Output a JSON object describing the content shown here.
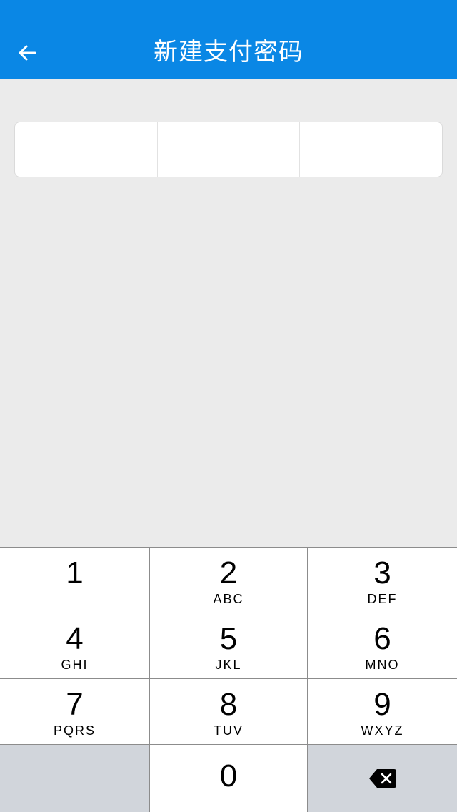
{
  "nav": {
    "title": "新建支付密码",
    "back_icon": "arrow-left-icon"
  },
  "pin": {
    "length": 6,
    "filled": 0
  },
  "keypad": {
    "keys": [
      {
        "digit": "1",
        "letters": ""
      },
      {
        "digit": "2",
        "letters": "ABC"
      },
      {
        "digit": "3",
        "letters": "DEF"
      },
      {
        "digit": "4",
        "letters": "GHI"
      },
      {
        "digit": "5",
        "letters": "JKL"
      },
      {
        "digit": "6",
        "letters": "MNO"
      },
      {
        "digit": "7",
        "letters": "PQRS"
      },
      {
        "digit": "8",
        "letters": "TUV"
      },
      {
        "digit": "9",
        "letters": "WXYZ"
      },
      {
        "digit": "0",
        "letters": ""
      }
    ],
    "delete_icon": "backspace-icon"
  },
  "colors": {
    "nav_background": "#0a87e5",
    "page_background": "#ebebeb",
    "key_background": "#ffffff",
    "special_key_background": "#d1d5db"
  }
}
